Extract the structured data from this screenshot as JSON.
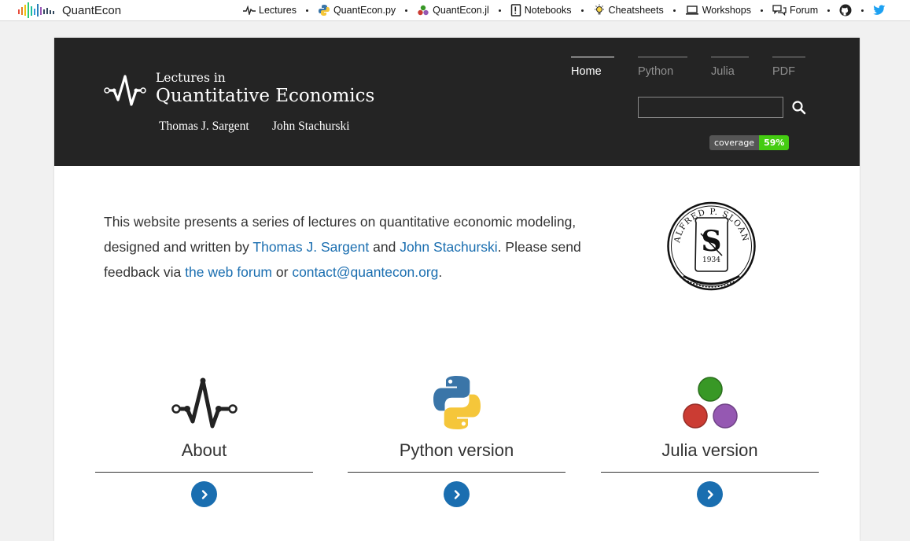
{
  "topbar": {
    "brand": "QuantEcon",
    "links": [
      {
        "label": "Lectures",
        "icon": "pulse-icon"
      },
      {
        "label": "QuantEcon.py",
        "icon": "python-icon"
      },
      {
        "label": "QuantEcon.jl",
        "icon": "julia-icon"
      },
      {
        "label": "Notebooks",
        "icon": "notebook-icon"
      },
      {
        "label": "Cheatsheets",
        "icon": "lightbulb-icon"
      },
      {
        "label": "Workshops",
        "icon": "laptop-icon"
      },
      {
        "label": "Forum",
        "icon": "chat-icon"
      }
    ]
  },
  "header": {
    "title_small": "Lectures in",
    "title_big": "Quantitative Economics",
    "authors": [
      "Thomas J. Sargent",
      "John Stachurski"
    ],
    "tabs": [
      "Home",
      "Python",
      "Julia",
      "PDF"
    ],
    "active_tab": "Home",
    "search_value": "",
    "badge": {
      "label": "coverage",
      "value": "59%",
      "color": "#44cc11"
    }
  },
  "intro": {
    "part1": "This website presents a series of lectures on quantitative economic modeling, designed and written by ",
    "link1": "Thomas J. Sargent",
    "part2": " and ",
    "link2": "John Stachurski",
    "part3": ". Please send feedback via ",
    "link3": "the web forum",
    "part4": " or ",
    "link4": "contact@quantecon.org",
    "part5": "."
  },
  "seal": {
    "text": "ALFRED P. SLOAN FOUNDATION",
    "year": "1934"
  },
  "cards": [
    {
      "label": "About"
    },
    {
      "label": "Python version"
    },
    {
      "label": "Julia version"
    }
  ],
  "colors": {
    "link": "#1a6eb0",
    "header_bg": "#242424"
  }
}
